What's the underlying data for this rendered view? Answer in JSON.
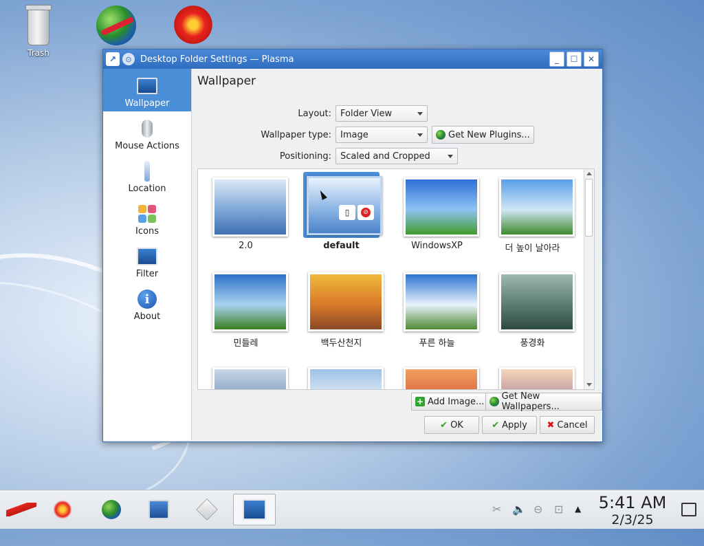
{
  "desktop": {
    "icons": [
      {
        "label": "Trash"
      },
      {
        "label": ""
      },
      {
        "label": ""
      }
    ]
  },
  "window": {
    "title": "Desktop Folder Settings — Plasma",
    "controls": {
      "minimize": "_",
      "maximize": "☐",
      "close": "✕"
    },
    "sidebar": [
      {
        "label": "Wallpaper",
        "icon": "monitor-icon",
        "active": true
      },
      {
        "label": "Mouse Actions",
        "icon": "mouse-icon"
      },
      {
        "label": "Location",
        "icon": "location-icon"
      },
      {
        "label": "Icons",
        "icon": "icons-icon"
      },
      {
        "label": "Filter",
        "icon": "filter-icon"
      },
      {
        "label": "About",
        "icon": "info-icon"
      }
    ],
    "heading": "Wallpaper",
    "form": {
      "layout_label": "Layout:",
      "layout_value": "Folder View",
      "type_label": "Wallpaper type:",
      "type_value": "Image",
      "get_plugins": "Get New Plugins...",
      "positioning_label": "Positioning:",
      "positioning_value": "Scaled and Cropped"
    },
    "wallpapers": [
      {
        "label": "2.0",
        "colors": [
          "#dbe8f6",
          "#7fa8d8",
          "#3e6fb0"
        ]
      },
      {
        "label": "default",
        "colors": [
          "#e9f2fc",
          "#8db6e4",
          "#4b83c8"
        ],
        "selected": true
      },
      {
        "label": "WindowsXP",
        "colors": [
          "#2f6fd6",
          "#8ec4f2",
          "#3f9a2a"
        ]
      },
      {
        "label": "더 높이 날아라",
        "colors": [
          "#5b9ee8",
          "#cfe6f6",
          "#3d8a2c"
        ]
      },
      {
        "label": "민들레",
        "colors": [
          "#2e72c9",
          "#a9d2f0",
          "#3a7d22"
        ]
      },
      {
        "label": "백두산천지",
        "colors": [
          "#f0b93a",
          "#d9792a",
          "#8a4a26"
        ]
      },
      {
        "label": "푸른 하늘",
        "colors": [
          "#2c73d2",
          "#e8f2fb",
          "#4d8a34"
        ]
      },
      {
        "label": "풍경화",
        "colors": [
          "#9fb8b1",
          "#5b7d73",
          "#2e4a40"
        ]
      },
      {
        "label": "",
        "colors": [
          "#c8d6e6",
          "#7e9ec2",
          "#4d6f96"
        ]
      },
      {
        "label": "",
        "colors": [
          "#9bc1e8",
          "#e8eef4",
          "#7d9fc0"
        ]
      },
      {
        "label": "",
        "colors": [
          "#f2a060",
          "#d9603a",
          "#7a3a40"
        ]
      },
      {
        "label": "",
        "colors": [
          "#f3d7b8",
          "#b88aa0",
          "#6b6aa0"
        ]
      }
    ],
    "add_image": "Add Image...",
    "get_wallpapers": "Get New Wallpapers...",
    "ok": "OK",
    "apply": "Apply",
    "cancel": "Cancel"
  },
  "taskbar": {
    "clock_time": "5:41 AM",
    "clock_date": "2/3/25"
  }
}
